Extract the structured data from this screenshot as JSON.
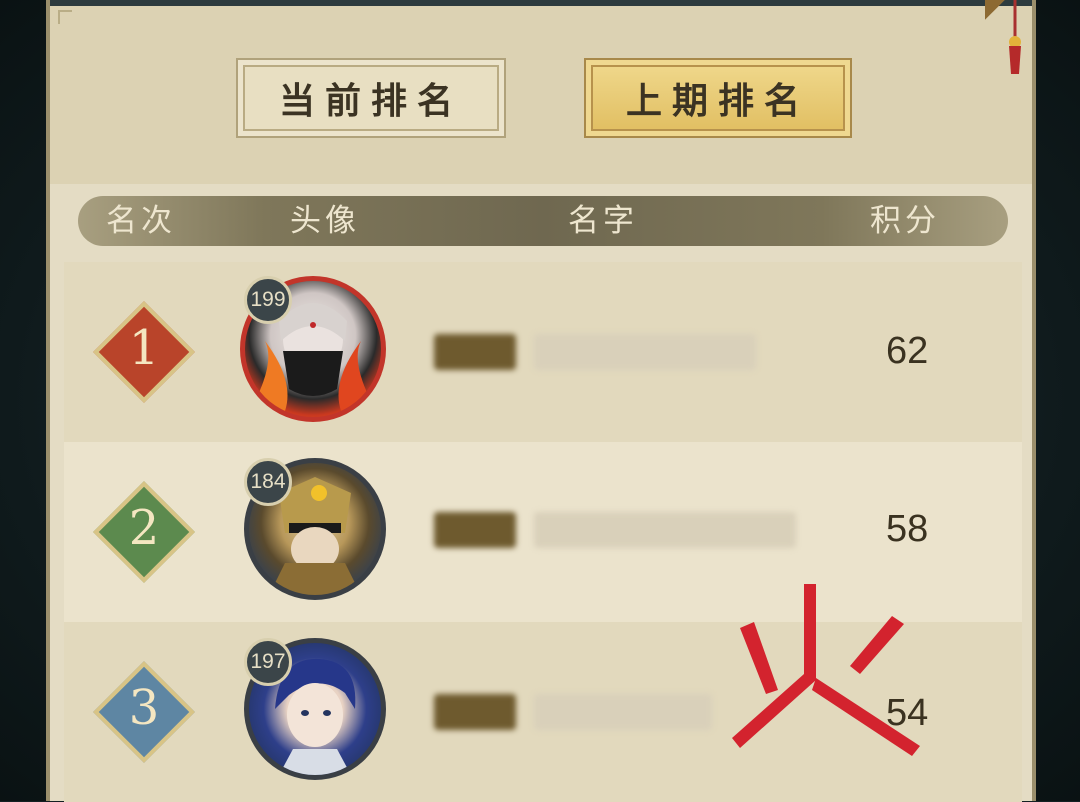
{
  "tabs": {
    "current_label": "当前排名",
    "last_label": "上期排名",
    "active": "last"
  },
  "columns": {
    "rank": "名次",
    "avatar": "头像",
    "name": "名字",
    "score": "积分"
  },
  "ranking": [
    {
      "rank": "1",
      "level": "199",
      "score": "62",
      "rank_color": "#b9442a",
      "avatar_icon": "masked-hero-avatar"
    },
    {
      "rank": "2",
      "level": "184",
      "score": "58",
      "rank_color": "#5c8a4e",
      "avatar_icon": "armored-general-avatar"
    },
    {
      "rank": "3",
      "level": "197",
      "score": "54",
      "rank_color": "#5e86a3",
      "avatar_icon": "blue-haired-scholar-avatar"
    }
  ],
  "watermark": {
    "icon": "fire-glyph-watermark",
    "color": "#d3232e"
  }
}
